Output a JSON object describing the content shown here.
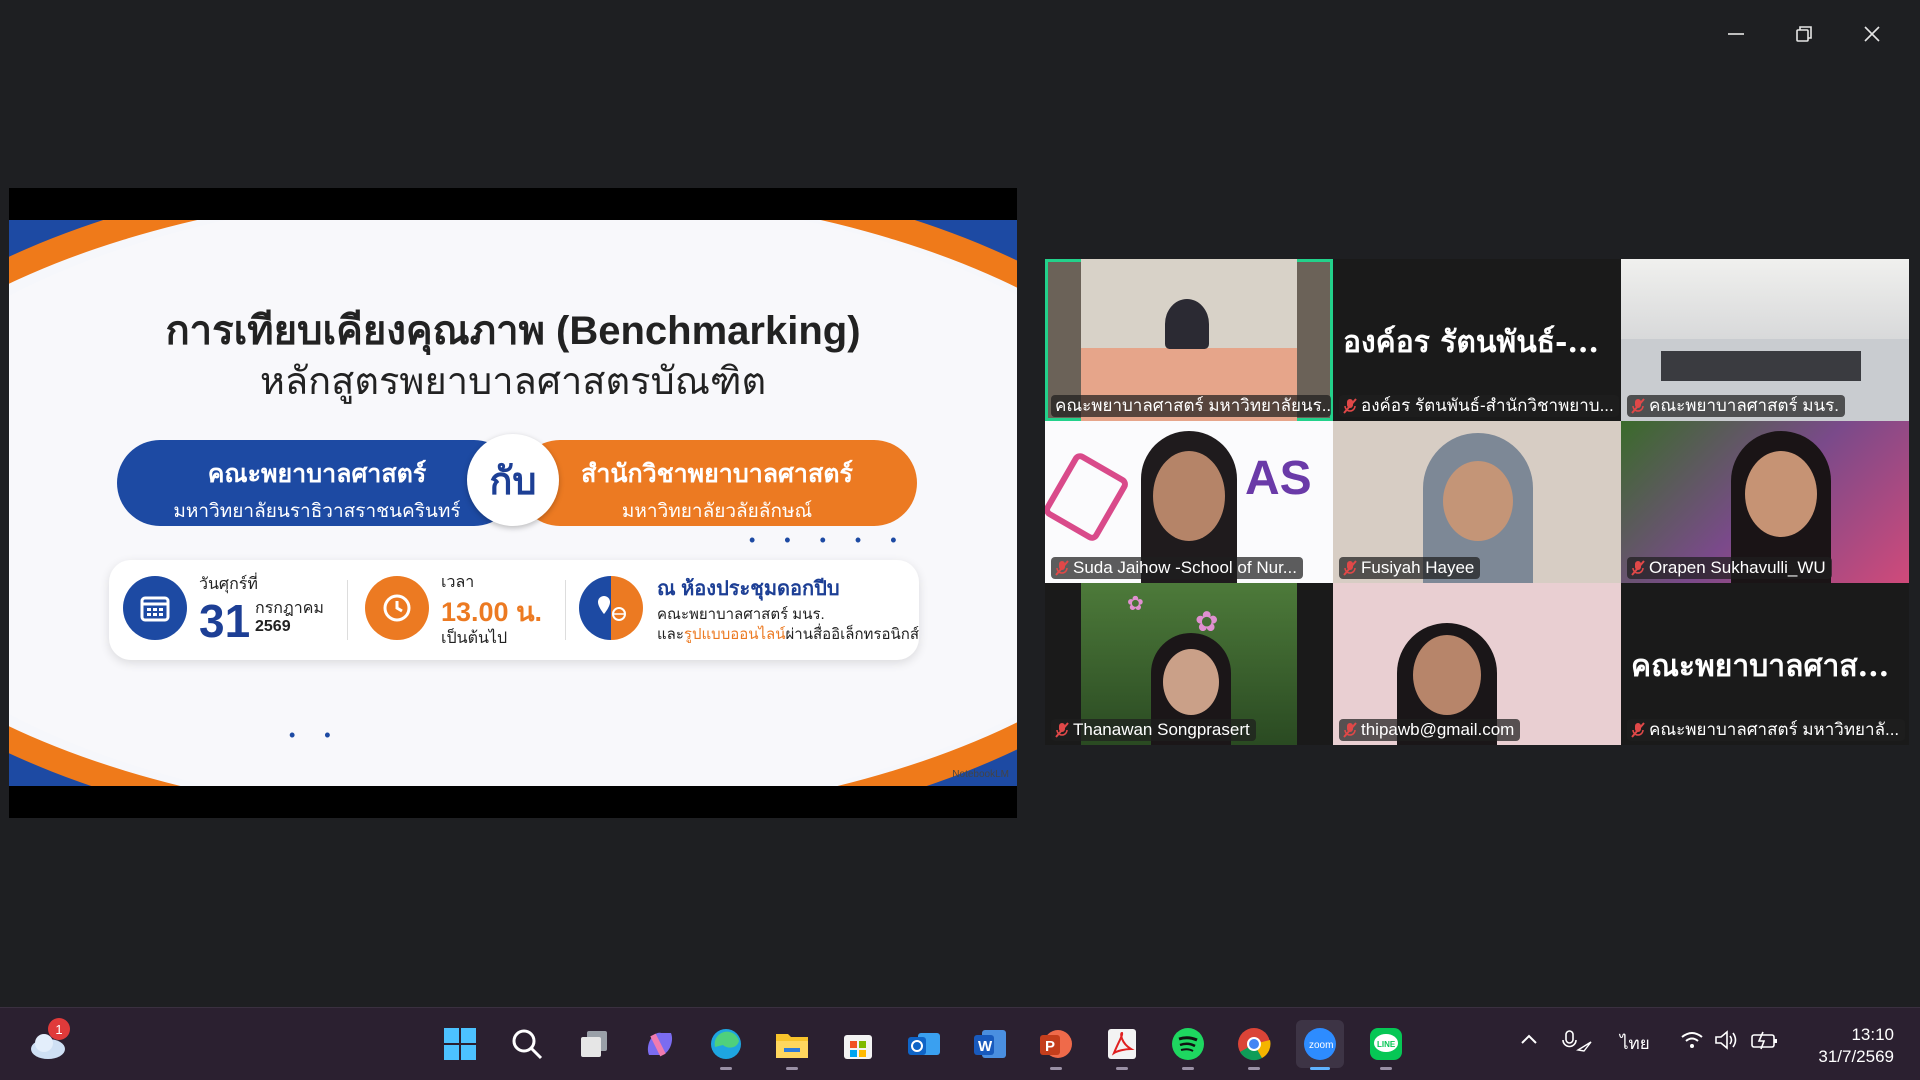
{
  "window": {
    "controls": [
      "minimize-icon",
      "restore-icon",
      "close-icon"
    ]
  },
  "slide": {
    "title": "การเทียบเคียงคุณภาพ (Benchmarking)",
    "subtitle": "หลักสูตรพยาบาลศาสตรบัณฑิต",
    "left_main": "คณะพยาบาลศาสตร์",
    "left_sub": "มหาวิทยาลัยนราธิวาสราชนครินทร์",
    "connector": "กับ",
    "right_main": "สำนักวิชาพยาบาลศาสตร์",
    "right_sub": "มหาวิทยาลัยวลัยลักษณ์",
    "day_label": "วันศุกร์ที่",
    "day_number": "31",
    "month": "กรกฎาคม",
    "year": "2569",
    "time_label": "เวลา",
    "time_value": "13.00 น.",
    "time_after": "เป็นต้นไป",
    "place_title": "ณ ห้องประชุมดอกปีบ",
    "place_line1": "คณะพยาบาลศาสตร์ มนร.",
    "place_line2_prefix": "และ",
    "place_line2_highlight": "รูปแบบออนไลน์",
    "place_line2_suffix": "ผ่านสื่ออิเล็กทรอนิกส์",
    "watermark": "NotebookLM",
    "colors": {
      "blue": "#1d4aa3",
      "orange": "#ec7a22"
    }
  },
  "participants": [
    {
      "name": "คณะพยาบาลศาสตร์ มหาวิทยาลัยนร...",
      "active": true,
      "muted": false,
      "video": true
    },
    {
      "name": "องค์อร รัตนพันธ์-สำนักวิชาพยาบ...",
      "display": "องค์อร รัตนพันธ์-...",
      "muted": true,
      "video": false
    },
    {
      "name": "คณะพยาบาลศาสตร์ มนร.",
      "muted": true,
      "video": true
    },
    {
      "name": "Suda Jaihow -School of Nur...",
      "muted": true,
      "video": true
    },
    {
      "name": "Fusiyah Hayee",
      "muted": true,
      "video": true
    },
    {
      "name": "Orapen Sukhavulli_WU",
      "muted": true,
      "video": true
    },
    {
      "name": "Thanawan Songprasert",
      "muted": true,
      "video": true
    },
    {
      "name": "thipawb@gmail.com",
      "muted": true,
      "video": true
    },
    {
      "name": "คณะพยาบาลศาสตร์ มหาวิทยาลั...",
      "display": "คณะพยาบาลศาส...",
      "muted": true,
      "video": false
    }
  ],
  "taskbar": {
    "weather_badge": "1",
    "apps": [
      "start-icon",
      "search-icon",
      "task-view-icon",
      "copilot-icon",
      "edge-icon",
      "file-explorer-icon",
      "store-icon",
      "outlook-icon",
      "word-icon",
      "powerpoint-icon",
      "acrobat-icon",
      "spotify-icon",
      "chrome-icon",
      "zoom-icon",
      "line-icon"
    ],
    "zoom_label": "zoom",
    "line_label": "LINE",
    "word_label": "W",
    "ppt_label": "P",
    "language": "ไทย",
    "time": "13:10",
    "date": "31/7/2569"
  }
}
